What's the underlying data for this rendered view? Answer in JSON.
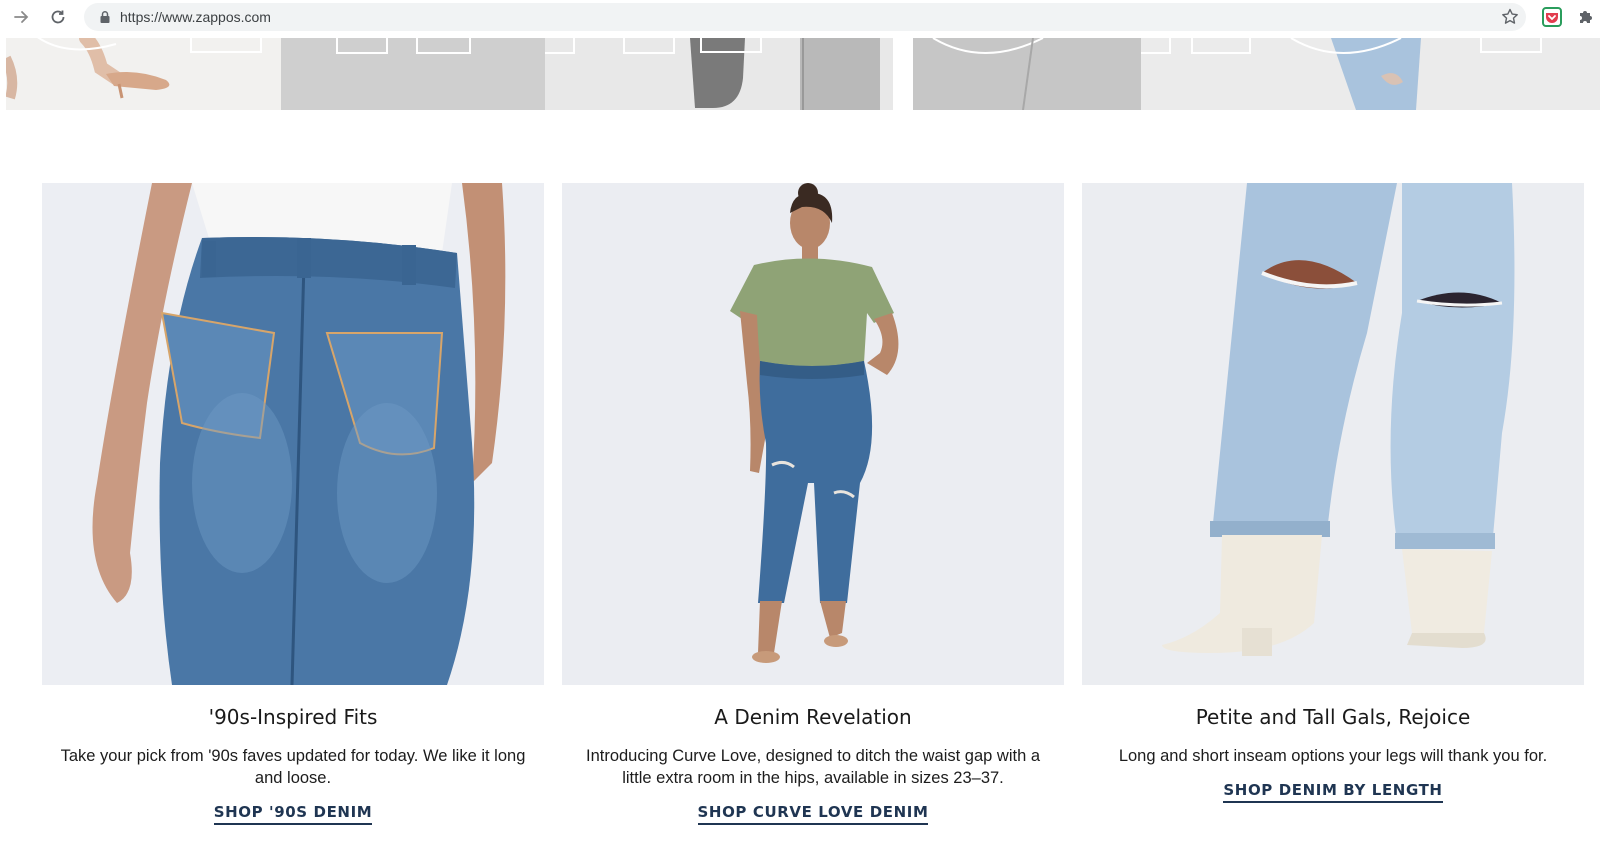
{
  "browser": {
    "url": "https://www.zappos.com",
    "icons": {
      "forward": "arrow-right-icon",
      "reload": "reload-icon",
      "lock": "lock-icon",
      "bookmark": "star-icon",
      "pocket_extension": "pocket-icon",
      "extensions": "puzzle-icon"
    }
  },
  "colors": {
    "link": "#1f3552",
    "text": "#1c1c1c",
    "photo_background": "#eceef3",
    "denim_dark": "#3f6d9d",
    "denim_light": "#a9c3dd"
  },
  "cards": [
    {
      "title": "'90s-Inspired Fits",
      "description": "Take your pick from '90s faves updated for today. We like it long and loose.",
      "link_label": "SHOP '90S DENIM"
    },
    {
      "title": "A Denim Revelation",
      "description": "Introducing Curve Love, designed to ditch the waist gap with a little extra room in the hips, available in sizes 23–37.",
      "link_label": "SHOP CURVE LOVE DENIM"
    },
    {
      "title": "Petite and Tall Gals, Rejoice",
      "description": "Long and short inseam options your legs will thank you for.",
      "link_label": "SHOP DENIM BY LENGTH"
    }
  ]
}
